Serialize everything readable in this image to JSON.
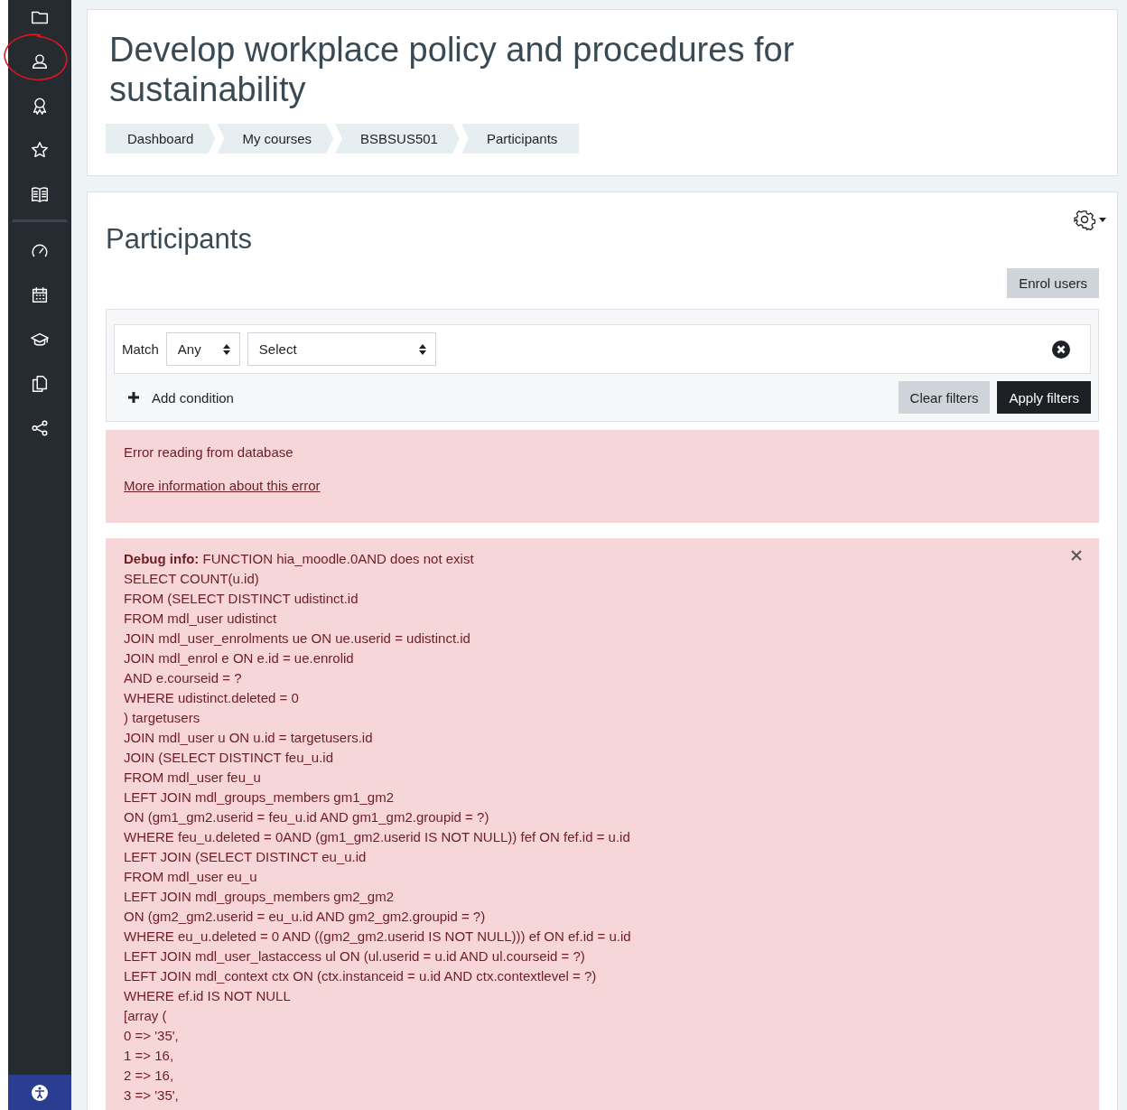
{
  "page_title": "Develop workplace policy and procedures for sustainability",
  "breadcrumbs": [
    "Dashboard",
    "My courses",
    "BSBSUS501",
    "Participants"
  ],
  "participants": {
    "heading": "Participants",
    "enrol_button": "Enrol users",
    "filter": {
      "match_label": "Match",
      "match_value": "Any",
      "field_value": "Select",
      "add_condition": "Add condition",
      "clear_button": "Clear filters",
      "apply_button": "Apply filters"
    },
    "error": {
      "message": "Error reading from database",
      "link": "More information about this error"
    },
    "debug": {
      "lines": [
        "**Debug info:** FUNCTION hia_moodle.0AND does not exist",
        "SELECT COUNT(u.id)",
        "FROM (SELECT DISTINCT udistinct.id",
        "FROM mdl_user udistinct",
        "JOIN mdl_user_enrolments ue ON ue.userid = udistinct.id",
        "JOIN mdl_enrol e ON e.id = ue.enrolid",
        "AND e.courseid = ?",
        "WHERE udistinct.deleted = 0",
        ") targetusers",
        "JOIN mdl_user u ON u.id = targetusers.id",
        "JOIN (SELECT DISTINCT feu_u.id",
        "FROM mdl_user feu_u",
        "LEFT JOIN mdl_groups_members gm1_gm2",
        "ON (gm1_gm2.userid = feu_u.id AND gm1_gm2.groupid = ?)",
        "WHERE feu_u.deleted = 0AND (gm1_gm2.userid IS NOT NULL)) fef ON fef.id = u.id",
        "LEFT JOIN (SELECT DISTINCT eu_u.id",
        "FROM mdl_user eu_u",
        "LEFT JOIN mdl_groups_members gm2_gm2",
        "ON (gm2_gm2.userid = eu_u.id AND gm2_gm2.groupid = ?)",
        "WHERE eu_u.deleted = 0 AND ((gm2_gm2.userid IS NOT NULL))) ef ON ef.id = u.id",
        "LEFT JOIN mdl_user_lastaccess ul ON (ul.userid = u.id AND ul.courseid = ?)",
        "LEFT JOIN mdl_context ctx ON (ctx.instanceid = u.id AND ctx.contextlevel = ?)",
        "WHERE ef.id IS NOT NULL",
        "[array (",
        "0 => '35',",
        "1 => 16,",
        "2 => 16,",
        "3 => '35',"
      ]
    }
  }
}
